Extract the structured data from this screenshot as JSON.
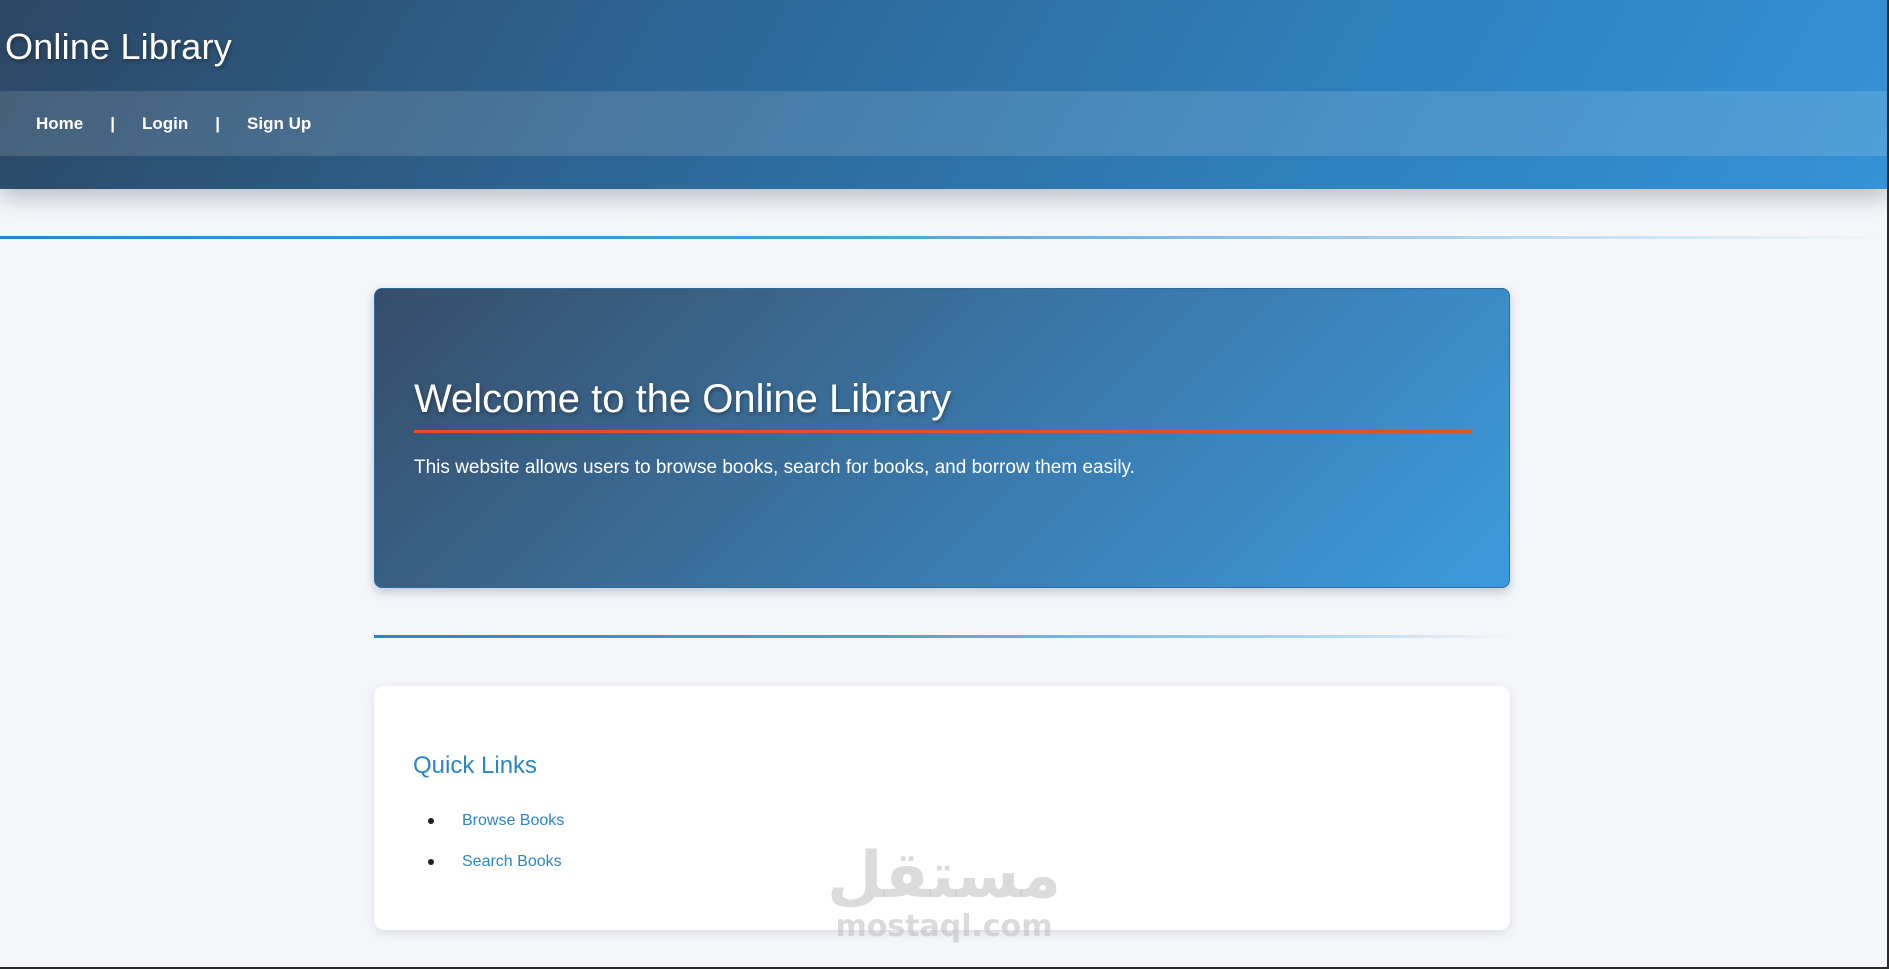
{
  "header": {
    "title": "Online Library",
    "nav": {
      "home": "Home",
      "login": "Login",
      "signup": "Sign Up",
      "separator": "|"
    }
  },
  "hero": {
    "title": "Welcome to the Online Library",
    "description": "This website allows users to browse books, search for books, and borrow them easily."
  },
  "quick_links": {
    "title": "Quick Links",
    "items": [
      {
        "label": "Browse Books"
      },
      {
        "label": "Search Books"
      }
    ]
  },
  "watermark": {
    "arabic": "مستقل",
    "latin": "mostaql.com"
  },
  "colors": {
    "accent": "#2b86c5",
    "hero_underline": "#d9532f",
    "header_start": "#2c4763",
    "header_end": "#3592d6",
    "background": "#f4f6fa"
  }
}
